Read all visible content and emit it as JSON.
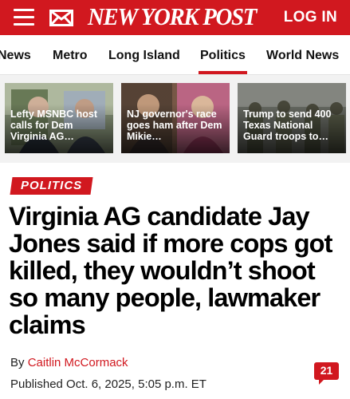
{
  "header": {
    "logo_text": "NEW YORK POST",
    "login_label": "LOG IN",
    "brand_color": "#d1181f"
  },
  "nav": {
    "items": [
      {
        "label": "News"
      },
      {
        "label": "Metro"
      },
      {
        "label": "Long Island"
      },
      {
        "label": "Politics",
        "active": true
      },
      {
        "label": "World News"
      }
    ]
  },
  "stories": [
    {
      "title": "Lefty MSNBC host calls for Dem Virginia AG…"
    },
    {
      "title": "NJ governor's race goes ham after Dem Mikie…"
    },
    {
      "title": "Trump to send 400 Texas National Guard troops to…"
    }
  ],
  "article": {
    "section": "POLITICS",
    "headline": "Virginia AG candidate Jay Jones said if more cops got killed, they wouldn’t shoot so many people, lawmaker claims",
    "byline_prefix": "By",
    "author": "Caitlin McCormack",
    "published": "Published Oct. 6, 2025, 5:05 p.m. ET",
    "comment_count": "21"
  },
  "icons": [
    "hamburger-menu-icon",
    "mail-icon",
    "comment-bubble-icon"
  ]
}
